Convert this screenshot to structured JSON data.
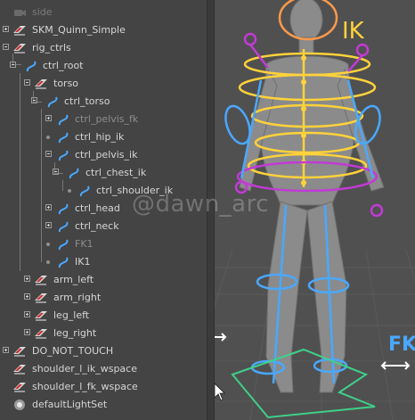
{
  "outliner": {
    "rows": [
      {
        "label": "side"
      },
      {
        "label": "SKM_Quinn_Simple"
      },
      {
        "label": "rig_ctrls"
      },
      {
        "label": "ctrl_root"
      },
      {
        "label": "torso"
      },
      {
        "label": "ctrl_torso"
      },
      {
        "label": "ctrl_pelvis_fk"
      },
      {
        "label": "ctrl_hip_ik"
      },
      {
        "label": "ctrl_pelvis_ik"
      },
      {
        "label": "ctrl_chest_ik"
      },
      {
        "label": "ctrl_shoulder_ik"
      },
      {
        "label": "ctrl_head"
      },
      {
        "label": "ctrl_neck"
      },
      {
        "label": "FK1"
      },
      {
        "label": "IK1"
      },
      {
        "label": "arm_left"
      },
      {
        "label": "arm_right"
      },
      {
        "label": "leg_left"
      },
      {
        "label": "leg_right"
      },
      {
        "label": "DO_NOT_TOUCH"
      },
      {
        "label": "shoulder_l_ik_wspace"
      },
      {
        "label": "shoulder_l_fk_wspace"
      },
      {
        "label": "defaultLightSet"
      }
    ]
  },
  "viewport": {
    "labels": {
      "ik": "IK",
      "fk": "FK"
    },
    "watermark": "@dawn_arc"
  },
  "colors": {
    "outliner_bg": "#444444",
    "text": "#d6d6d6",
    "text_dim": "#8d8d8d",
    "viewport_bg": "#505050",
    "ctrl_blue": "#4aa8ff",
    "ctrl_yellow": "#ffd23a",
    "ctrl_purple": "#c23ad6",
    "ctrl_orange": "#ff9a4a",
    "ctrl_green": "#3fd08a"
  }
}
